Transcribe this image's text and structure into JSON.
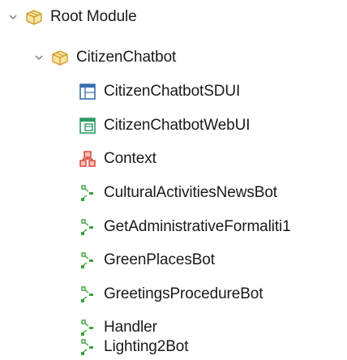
{
  "tree": {
    "root": {
      "label": "Root Module",
      "icon": "package-icon",
      "expanded": true
    },
    "module": {
      "label": "CitizenChatbot",
      "icon": "package-icon",
      "expanded": true
    },
    "items": [
      {
        "label": "CitizenChatbotSDUI",
        "icon": "panel-layout-icon"
      },
      {
        "label": "CitizenChatbotWebUI",
        "icon": "web-panel-icon"
      },
      {
        "label": "Context",
        "icon": "context-icon"
      },
      {
        "label": "CulturalActivitiesNewsBot",
        "icon": "flow-icon"
      },
      {
        "label": "GetAdministrativeFormaliti1",
        "icon": "flow-icon"
      },
      {
        "label": "GreenPlacesBot",
        "icon": "flow-icon"
      },
      {
        "label": "GreetingsProcedureBot",
        "icon": "flow-icon"
      },
      {
        "label": "Handler",
        "icon": "flow-icon"
      },
      {
        "label": "Lighting2Bot",
        "icon": "flow-icon"
      }
    ]
  },
  "colors": {
    "package": "#f0c050",
    "package_stroke": "#c79a2b",
    "panel_blue": "#3a6fb0",
    "web_green": "#2e9a62",
    "context_red": "#d6402e",
    "flow_green": "#3aa33a",
    "chevron": "#7a7a7a"
  }
}
